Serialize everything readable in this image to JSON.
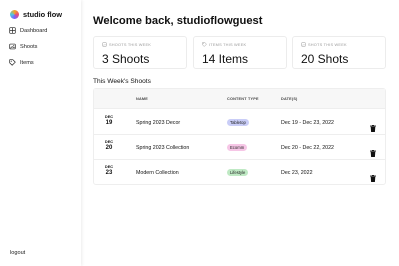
{
  "app": {
    "name": "studio flow"
  },
  "sidebar": {
    "items": [
      {
        "label": "Dashboard",
        "icon": "grid-icon"
      },
      {
        "label": "Shoots",
        "icon": "image-icon"
      },
      {
        "label": "Items",
        "icon": "tag-icon"
      }
    ],
    "logout_label": "logout"
  },
  "header": {
    "welcome": "Welcome back, studioflowguest"
  },
  "stats": [
    {
      "label": "SHOOTS THIS WEEK",
      "value": "3 Shoots",
      "icon": "image-icon"
    },
    {
      "label": "ITEMS THIS WEEK",
      "value": "14 Items",
      "icon": "tag-icon"
    },
    {
      "label": "SHOTS THIS WEEK",
      "value": "20 Shots",
      "icon": "image-icon"
    }
  ],
  "shoots": {
    "title": "This Week's Shoots",
    "columns": [
      "NAME",
      "CONTENT TYPE",
      "DATE(S)"
    ],
    "rows": [
      {
        "month": "DEC",
        "day": "19",
        "name": "Spring 2023 Decor",
        "type": "Tabletop",
        "dates": "Dec 19 - Dec 23, 2022"
      },
      {
        "month": "DEC",
        "day": "20",
        "name": "Spring 2023 Collection",
        "type": "Ecomm",
        "dates": "Dec 20 - Dec 22, 2022"
      },
      {
        "month": "DEC",
        "day": "23",
        "name": "Modern Collection",
        "type": "Lifestyle",
        "dates": "Dec 23, 2022"
      }
    ]
  },
  "colors": {
    "tabletop_badge": "#c9cdf7",
    "ecomm_badge": "#f6c6e6",
    "lifestyle_badge": "#bfe9c4",
    "header_bg": "#f7f7f7"
  }
}
